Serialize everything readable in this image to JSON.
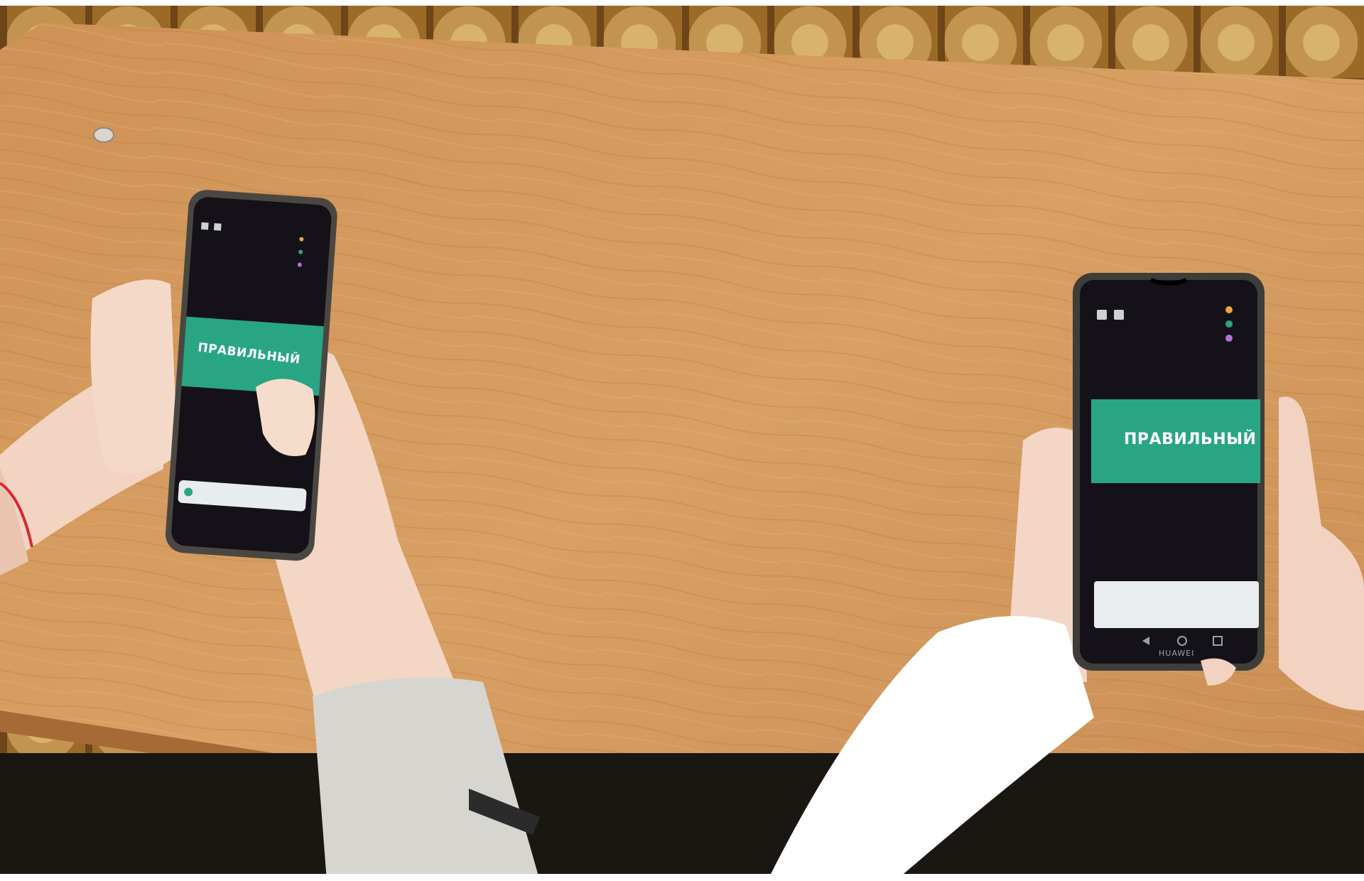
{
  "scene": {
    "left_phone": {
      "answer_label": "ПРАВИЛЬНЫЙ"
    },
    "right_phone": {
      "answer_label": "ПРАВИЛЬНЫЙ",
      "brand": "HUAWEI"
    }
  },
  "colors": {
    "desk": "#d49a5c",
    "answer_banner": "#2aa584",
    "phone_screen": "#141218",
    "parquet": "#a8782f"
  }
}
